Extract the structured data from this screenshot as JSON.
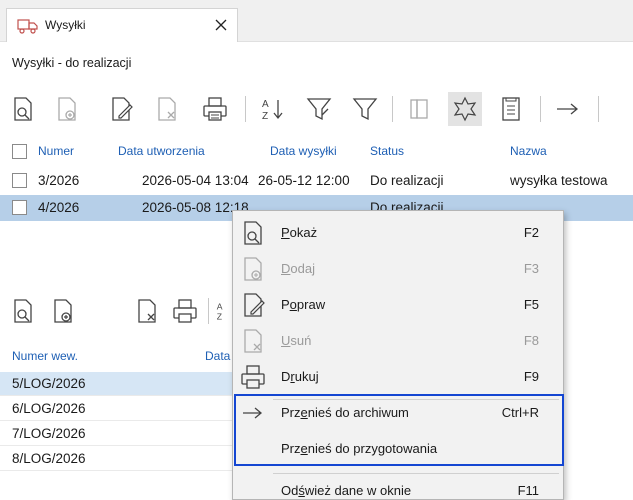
{
  "tab": {
    "title": "Wysyłki"
  },
  "subtitle": "Wysyłki - do realizacji",
  "toolbar": {
    "icons": [
      "show-icon",
      "add-icon",
      "edit-icon",
      "delete-icon",
      "print-icon",
      "sort-icon",
      "filter-clear-icon",
      "filter-icon",
      "columns-icon",
      "star-icon",
      "form-icon",
      "arrow-icon"
    ]
  },
  "grid": {
    "headers": {
      "numer": "Numer",
      "data_utworzenia": "Data utworzenia",
      "data_wysylki": "Data wysyłki",
      "status": "Status",
      "nazwa": "Nazwa"
    },
    "rows": [
      {
        "numer": "3/2026",
        "data_utworzenia": "2026-05-04 13:04",
        "data_wysylki": "26-05-12 12:00",
        "status": "Do realizacji",
        "nazwa": "wysyłka testowa"
      },
      {
        "numer": "4/2026",
        "data_utworzenia": "2026-05-08 12:18",
        "data_wysylki": "",
        "status": "Do realizacji",
        "nazwa": ""
      }
    ]
  },
  "lower": {
    "headers": {
      "numer_wew": "Numer wew.",
      "data": "Data"
    },
    "rows": [
      "5/LOG/2026",
      "6/LOG/2026",
      "7/LOG/2026",
      "8/LOG/2026"
    ]
  },
  "menu": {
    "items": [
      {
        "label_pre": "",
        "label_u": "P",
        "label_post": "okaż",
        "key": "F2"
      },
      {
        "label_pre": "",
        "label_u": "D",
        "label_post": "odaj",
        "key": "F3"
      },
      {
        "label_pre": "P",
        "label_u": "o",
        "label_post": "praw",
        "key": "F5"
      },
      {
        "label_pre": "",
        "label_u": "U",
        "label_post": "suń",
        "key": "F8"
      },
      {
        "label_pre": "D",
        "label_u": "r",
        "label_post": "ukuj",
        "key": "F9"
      },
      {
        "label_pre": "Prz",
        "label_u": "e",
        "label_post": "nieś do archiwum",
        "key": "Ctrl+R"
      },
      {
        "label_pre": "Prz",
        "label_u": "e",
        "label_post": "nieś do przygotowania",
        "key": ""
      },
      {
        "label_pre": "Od",
        "label_u": "ś",
        "label_post": "wież dane w oknie",
        "key": "F11"
      }
    ]
  },
  "colors": {
    "selection": "#b6cfe8",
    "header_text": "#1e5fb4",
    "highlight_border": "#1446d2"
  }
}
